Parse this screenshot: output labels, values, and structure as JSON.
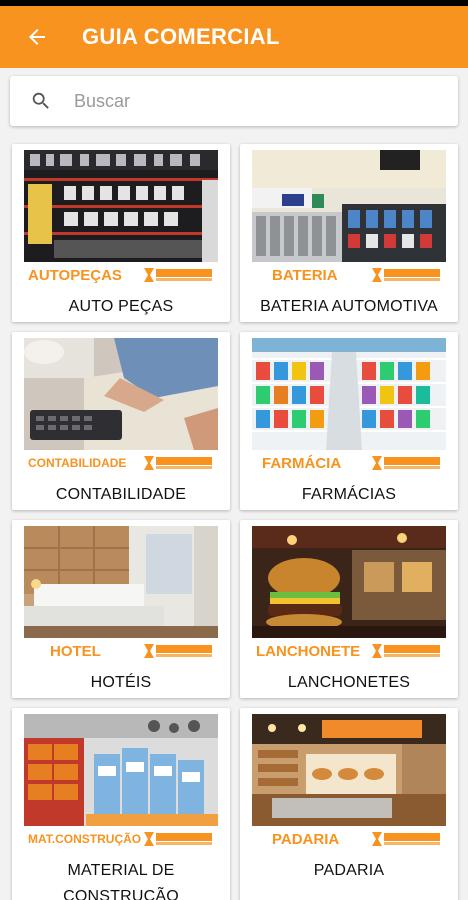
{
  "appbar": {
    "title": "GUIA COMERCIAL",
    "accent": "#f7931e"
  },
  "search": {
    "placeholder": "Buscar"
  },
  "cards": [
    {
      "category": "AUTOPEÇAS",
      "label": "AUTO PEÇAS",
      "image": "auto-parts-store"
    },
    {
      "category": "BATERIA",
      "label": "BATERIA AUTOMOTIVA",
      "image": "battery-store"
    },
    {
      "category": "CONTABILIDADE",
      "label": "CONTABILIDADE",
      "image": "accounting-calculator"
    },
    {
      "category": "FARMÁCIA",
      "label": "FARMÁCIAS",
      "image": "pharmacy-shelves"
    },
    {
      "category": "HOTEL",
      "label": "HOTÉIS",
      "image": "hotel-room"
    },
    {
      "category": "LANCHONETE",
      "label": "LANCHONETES",
      "image": "burger"
    },
    {
      "category": "MAT.CONSTRUÇÃO",
      "label": "MATERIAL DE CONSTRUÇÃO",
      "image": "construction-store"
    },
    {
      "category": "PADARIA",
      "label": "PADARIA",
      "image": "bakery-counter"
    }
  ]
}
